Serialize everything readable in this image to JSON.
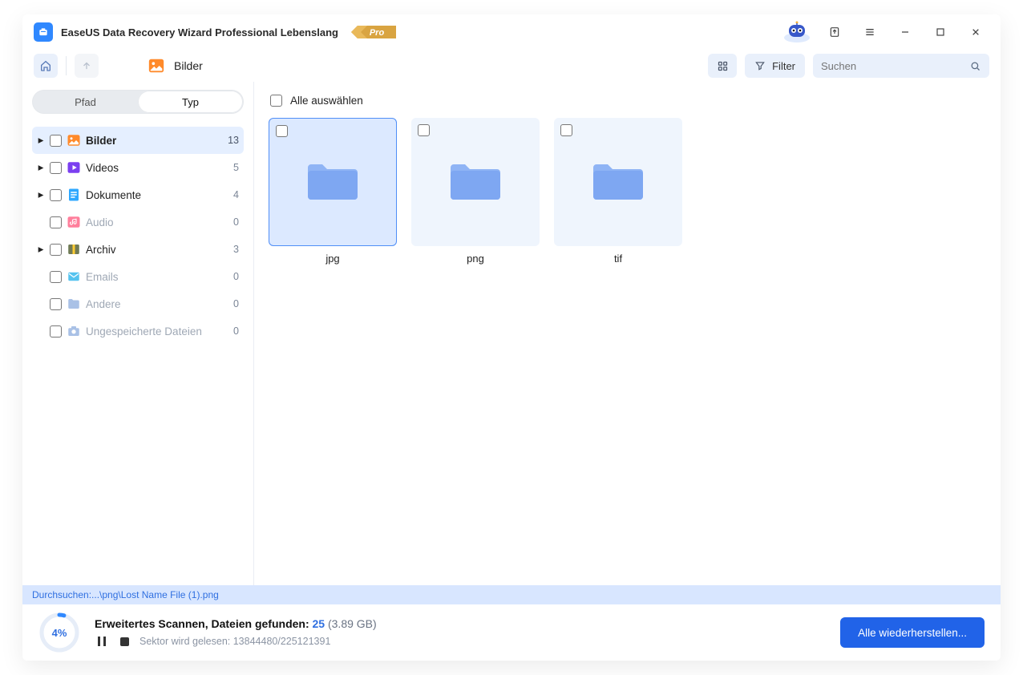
{
  "app": {
    "title": "EaseUS Data Recovery Wizard Professional Lebenslang",
    "badge": "Pro"
  },
  "toolbar": {
    "breadcrumb": "Bilder",
    "filter_label": "Filter",
    "search_placeholder": "Suchen"
  },
  "tabs": {
    "path": "Pfad",
    "type": "Typ"
  },
  "categories": [
    {
      "name": "Bilder",
      "count": 13,
      "expandable": true,
      "active": true,
      "icon": "image",
      "color": "#ff8a2b"
    },
    {
      "name": "Videos",
      "count": 5,
      "expandable": true,
      "icon": "play",
      "color": "#7b3ff0"
    },
    {
      "name": "Dokumente",
      "count": 4,
      "expandable": true,
      "icon": "doc",
      "color": "#2fa8ff"
    },
    {
      "name": "Audio",
      "count": 0,
      "expandable": false,
      "muted": true,
      "icon": "audio",
      "color": "#ff7f9c"
    },
    {
      "name": "Archiv",
      "count": 3,
      "expandable": true,
      "icon": "archive",
      "color": "#2faa5f"
    },
    {
      "name": "Emails",
      "count": 0,
      "expandable": false,
      "muted": true,
      "icon": "mail",
      "color": "#55c3ef"
    },
    {
      "name": "Andere",
      "count": 0,
      "expandable": false,
      "muted": true,
      "icon": "folder",
      "color": "#a9c1e6"
    },
    {
      "name": "Ungespeicherte Dateien",
      "count": 0,
      "expandable": false,
      "muted": true,
      "icon": "camera",
      "color": "#a9c1e6"
    }
  ],
  "select_all": "Alle auswählen",
  "folders": [
    {
      "label": "jpg",
      "selected": true
    },
    {
      "label": "png",
      "selected": false
    },
    {
      "label": "tif",
      "selected": false
    }
  ],
  "scan": {
    "path_prefix": "Durchsuchen: ",
    "path_value": "...\\png\\Lost Name File (1).png",
    "progress_pct": "4%",
    "line1_prefix": "Erweitertes Scannen, Dateien gefunden: ",
    "found_count": "25",
    "found_size": "(3.89 GB)",
    "sector_prefix": "Sektor wird gelesen: ",
    "sector_value": "13844480/225121391"
  },
  "recover_btn": "Alle wiederherstellen..."
}
